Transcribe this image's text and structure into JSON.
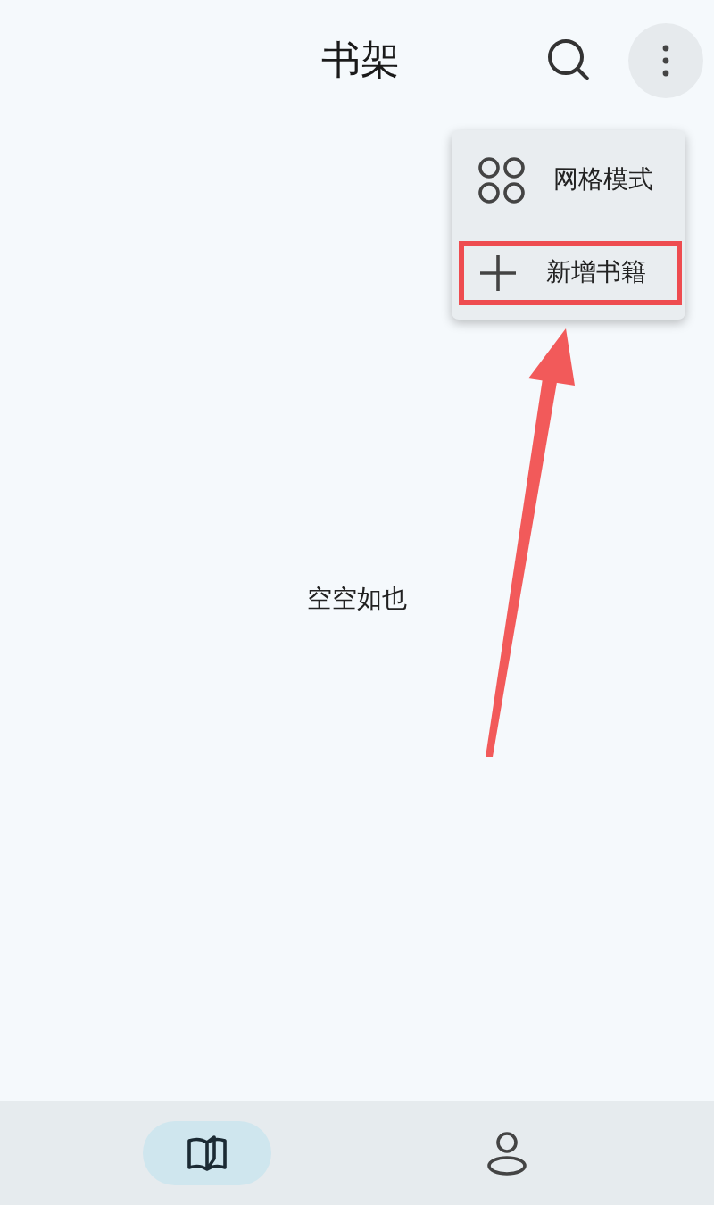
{
  "header": {
    "title": "书架"
  },
  "menu": [
    {
      "kind": "grid",
      "label": "网格模式",
      "highlighted": false
    },
    {
      "kind": "add",
      "label": "新增书籍",
      "highlighted": true
    }
  ],
  "empty_state": "空空如也",
  "nav": [
    {
      "kind": "shelf",
      "selected": true
    },
    {
      "kind": "profile",
      "selected": false
    }
  ]
}
